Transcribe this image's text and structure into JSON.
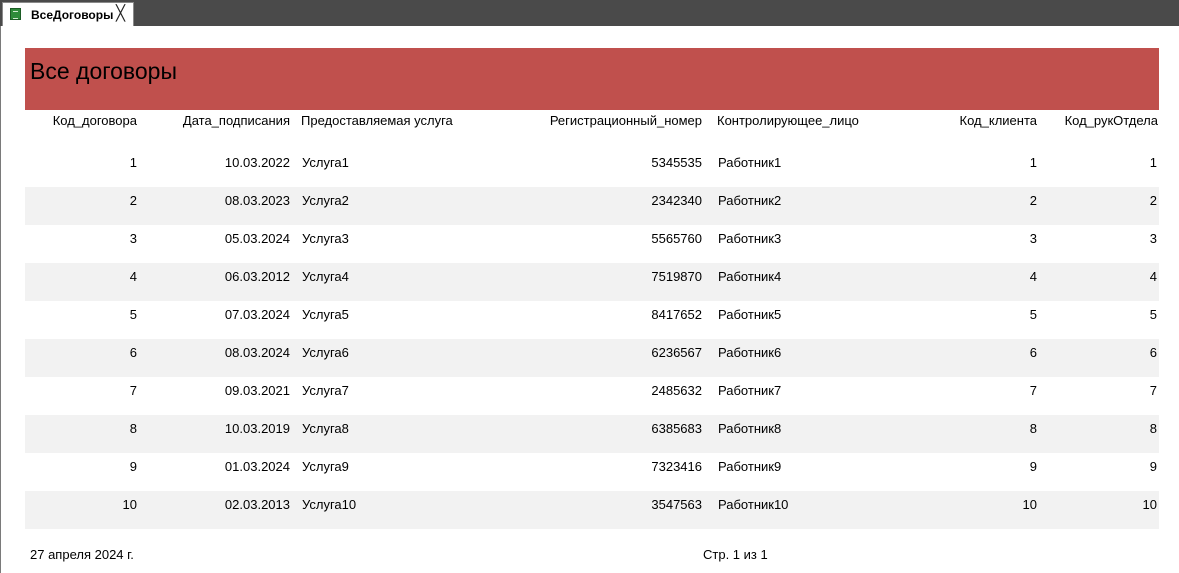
{
  "tab": {
    "label": "ВсеДоговоры",
    "close": "╳"
  },
  "report": {
    "title": "Все договоры",
    "columns": [
      "Код_договора",
      "Дата_подписания",
      "Предоставляемая услуга",
      "Регистрационный_номер",
      "Контролирующее_лицо",
      "Код_клиента",
      "Код_рукОтдела"
    ],
    "rows": [
      [
        "1",
        "10.03.2022",
        "Услуга1",
        "5345535",
        "Работник1",
        "1",
        "1"
      ],
      [
        "2",
        "08.03.2023",
        "Услуга2",
        "2342340",
        "Работник2",
        "2",
        "2"
      ],
      [
        "3",
        "05.03.2024",
        "Услуга3",
        "5565760",
        "Работник3",
        "3",
        "3"
      ],
      [
        "4",
        "06.03.2012",
        "Услуга4",
        "7519870",
        "Работник4",
        "4",
        "4"
      ],
      [
        "5",
        "07.03.2024",
        "Услуга5",
        "8417652",
        "Работник5",
        "5",
        "5"
      ],
      [
        "6",
        "08.03.2024",
        "Услуга6",
        "6236567",
        "Работник6",
        "6",
        "6"
      ],
      [
        "7",
        "09.03.2021",
        "Услуга7",
        "2485632",
        "Работник7",
        "7",
        "7"
      ],
      [
        "8",
        "10.03.2019",
        "Услуга8",
        "6385683",
        "Работник8",
        "8",
        "8"
      ],
      [
        "9",
        "01.03.2024",
        "Услуга9",
        "7323416",
        "Работник9",
        "9",
        "9"
      ],
      [
        "10",
        "02.03.2013",
        "Услуга10",
        "3547563",
        "Работник10",
        "10",
        "10"
      ]
    ]
  },
  "footer": {
    "date": "27 апреля 2024 г.",
    "page": "Стр. 1 из 1"
  },
  "colors": {
    "header_bg": "#c0504d",
    "alt_row_bg": "#f2f2f2",
    "tab_strip": "#4a4a4a"
  },
  "icons": {
    "tab_icon": "report-icon"
  }
}
